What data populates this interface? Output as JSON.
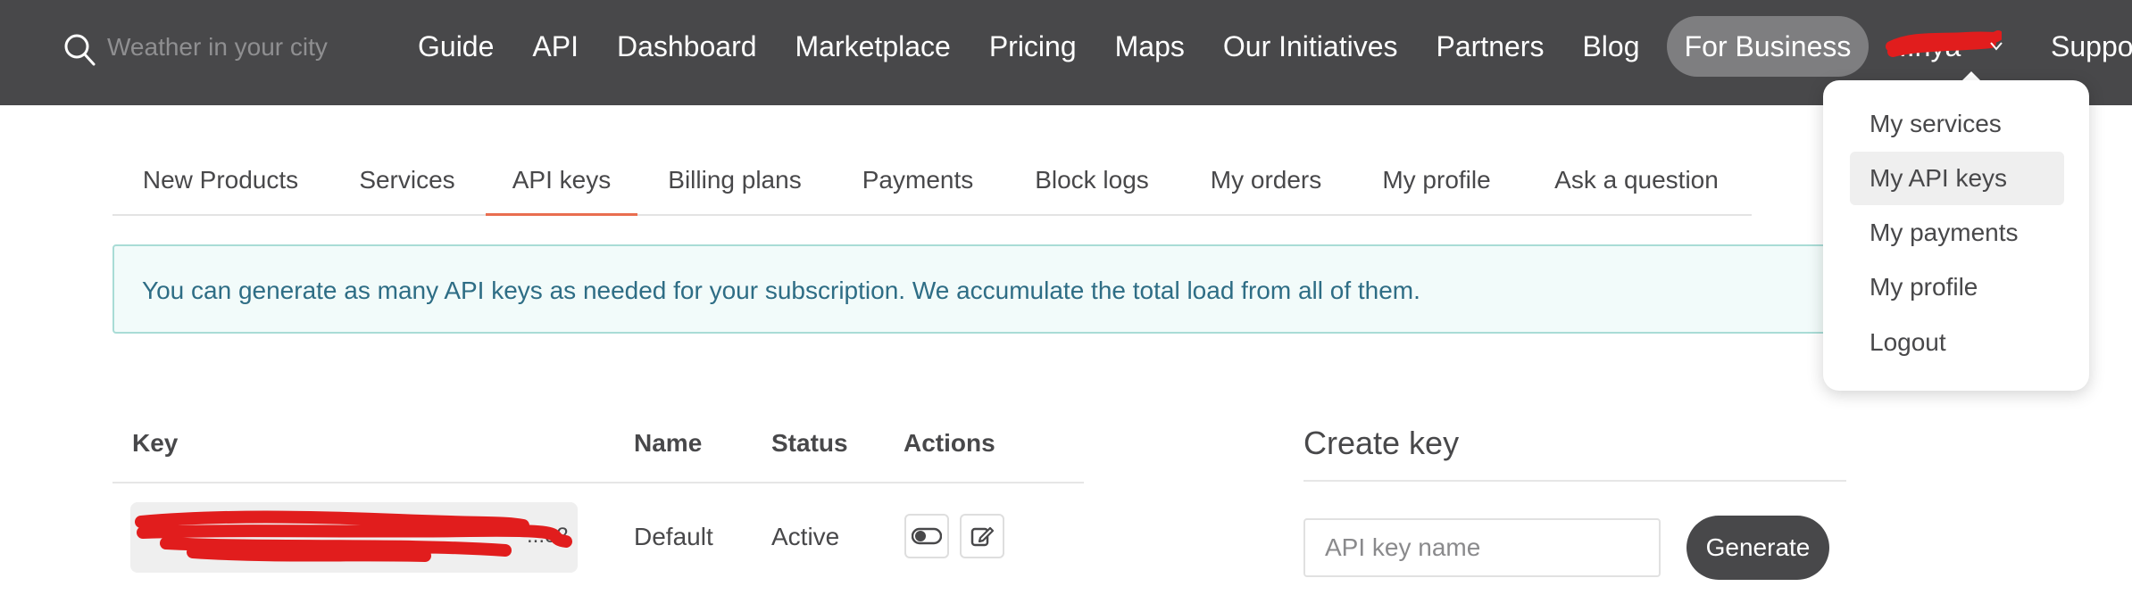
{
  "header": {
    "search": {
      "placeholder": "Weather in your city"
    },
    "nav": [
      "Guide",
      "API",
      "Dashboard",
      "Marketplace",
      "Pricing",
      "Maps",
      "Our Initiatives",
      "Partners",
      "Blog"
    ],
    "business_label": "For Business",
    "user_name": "...nya",
    "support_label": "Support",
    "colors": {
      "nav_bg": "#48484a",
      "pill_bg": "#7e7e80",
      "redaction": "#e11d1d"
    }
  },
  "tabs": {
    "items": [
      "New Products",
      "Services",
      "API keys",
      "Billing plans",
      "Payments",
      "Block logs",
      "My orders",
      "My profile",
      "Ask a question"
    ],
    "active": "API keys",
    "accent": "#e96e50"
  },
  "info": {
    "text": "You can generate as many API keys as needed for your subscription. We accumulate the total load from all of them."
  },
  "keys_table": {
    "headers": {
      "key": "Key",
      "name": "Name",
      "status": "Status",
      "actions": "Actions"
    },
    "rows": [
      {
        "key_suffix": "...e2",
        "name": "Default",
        "status": "Active",
        "actions": [
          "toggle-icon",
          "edit-icon"
        ]
      }
    ]
  },
  "create_key": {
    "title": "Create key",
    "input_placeholder": "API key name",
    "button_label": "Generate"
  },
  "dropdown": {
    "items": [
      "My services",
      "My API keys",
      "My payments",
      "My profile",
      "Logout"
    ],
    "active": "My API keys"
  }
}
